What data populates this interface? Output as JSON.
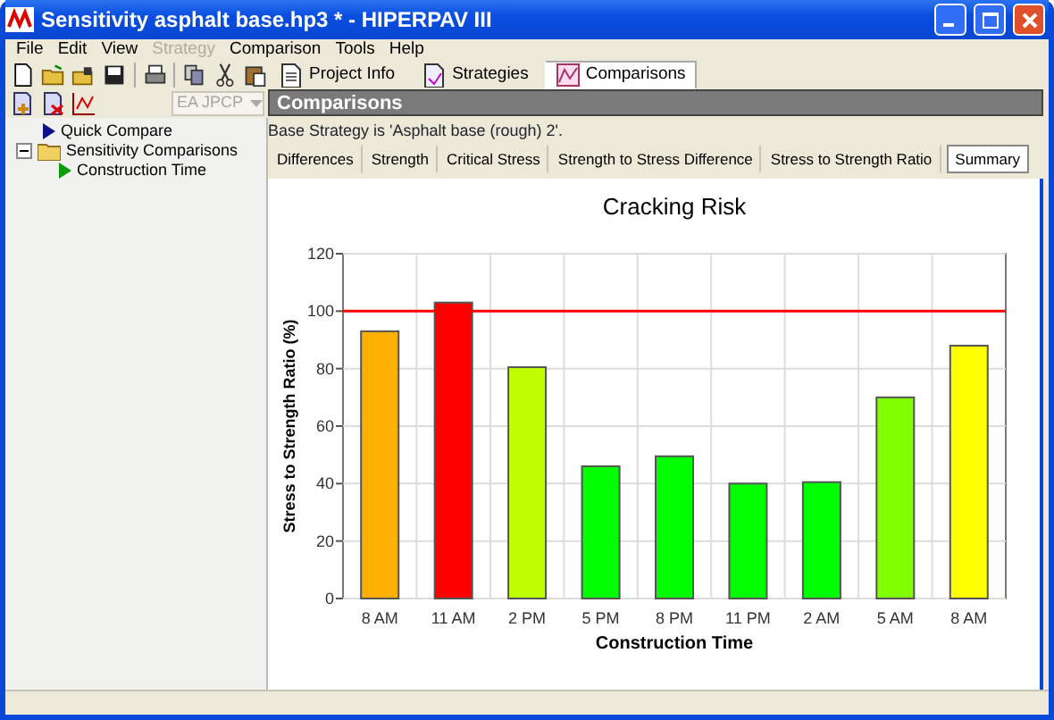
{
  "window": {
    "title": "Sensitivity asphalt base.hp3 * - HIPERPAV III"
  },
  "menu": [
    {
      "label": "File",
      "disabled": false
    },
    {
      "label": "Edit",
      "disabled": false
    },
    {
      "label": "View",
      "disabled": false
    },
    {
      "label": "Strategy",
      "disabled": true
    },
    {
      "label": "Comparison",
      "disabled": false
    },
    {
      "label": "Tools",
      "disabled": false
    },
    {
      "label": "Help",
      "disabled": false
    }
  ],
  "strategy_combo": {
    "value": "EA JPCP",
    "disabled": true
  },
  "main_tabs": [
    {
      "label": "Project Info",
      "selected": false
    },
    {
      "label": "Strategies",
      "selected": false
    },
    {
      "label": "Comparisons",
      "selected": true
    }
  ],
  "tree": [
    {
      "label": "Quick Compare",
      "kind": "compare"
    },
    {
      "label": "Sensitivity Comparisons",
      "kind": "folder",
      "expanded": true,
      "children": [
        {
          "label": "Construction Time",
          "kind": "run"
        }
      ]
    }
  ],
  "panel_title": "Comparisons",
  "base_strategy": "Base Strategy is 'Asphalt base (rough) 2'.",
  "sub_tabs": [
    {
      "label": "Differences",
      "selected": false
    },
    {
      "label": "Strength",
      "selected": false
    },
    {
      "label": "Critical Stress",
      "selected": false
    },
    {
      "label": "Strength to Stress Difference",
      "selected": false
    },
    {
      "label": "Stress to Strength Ratio",
      "selected": false
    },
    {
      "label": "Summary",
      "selected": true
    }
  ],
  "chart_data": {
    "type": "bar",
    "title": "Cracking Risk",
    "xlabel": "Construction Time",
    "ylabel": "Stress to Strength Ratio (%)",
    "categories": [
      "8 AM",
      "11 AM",
      "2 PM",
      "5 PM",
      "8 PM",
      "11 PM",
      "2 AM",
      "5 AM",
      "8 AM"
    ],
    "series": [
      {
        "values": [
          93,
          103,
          80.5,
          46,
          49.5,
          40,
          40.5,
          70,
          88
        ],
        "colors": [
          "#ffb000",
          "#ff0000",
          "#c0ff00",
          "#00ff00",
          "#00ff00",
          "#00ff00",
          "#00ff00",
          "#80ff00",
          "#ffff00"
        ]
      }
    ],
    "ylim": [
      0,
      120
    ],
    "yticks": [
      0,
      20,
      40,
      60,
      80,
      100,
      120
    ],
    "grid": true,
    "ref_lines": [
      {
        "axis": "y",
        "value": 100,
        "color": "#ff0000"
      }
    ]
  }
}
